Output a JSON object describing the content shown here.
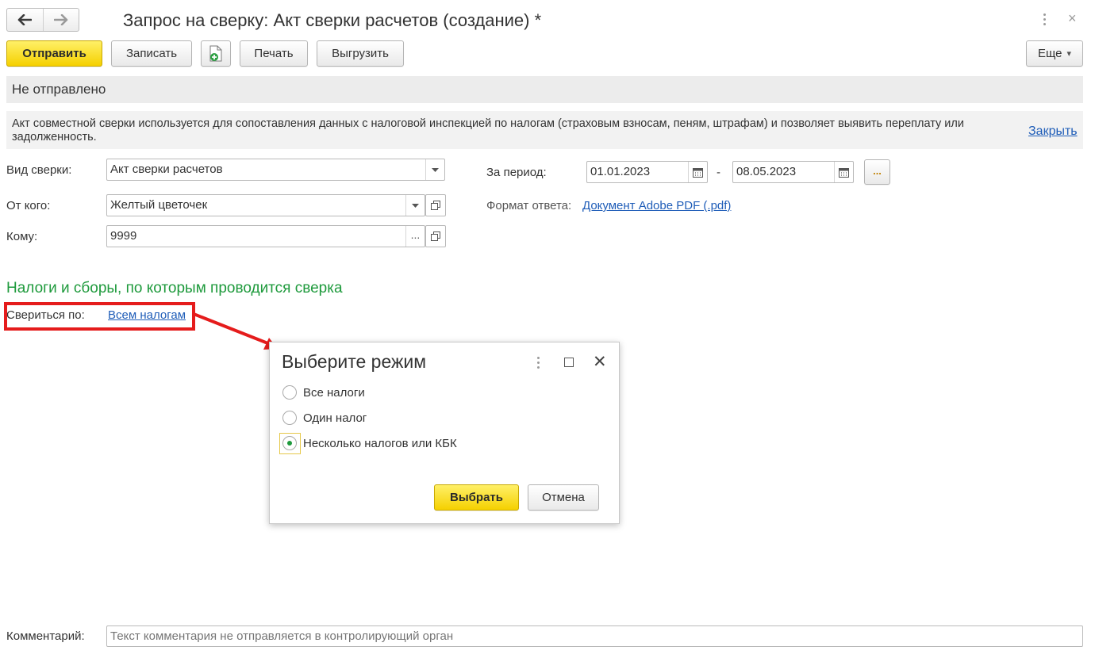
{
  "window": {
    "title": "Запрос на сверку: Акт сверки расчетов (создание) *",
    "close_glyph": "×"
  },
  "toolbar": {
    "send_label": "Отправить",
    "save_label": "Записать",
    "print_label": "Печать",
    "export_label": "Выгрузить",
    "more_label": "Еще",
    "more_arrow": "▾"
  },
  "status": "Не отправлено",
  "info": {
    "text": "Акт совместной сверки используется для сопоставления данных с налоговой инспекцией по налогам (страховым взносам, пеням, штрафам) и позволяет выявить переплату или задолженность.",
    "close_label": "Закрыть"
  },
  "form": {
    "type_label": "Вид сверки:",
    "type_value": "Акт сверки расчетов",
    "from_label": "От кого:",
    "from_value": "Желтый цветочек",
    "to_label": "Кому:",
    "to_value": "9999",
    "period_label": "За период:",
    "period_start": "01.01.2023",
    "period_dash": "-",
    "period_end": "08.05.2023",
    "format_label": "Формат ответа:",
    "format_value": "Документ Adobe PDF (.pdf)",
    "dots": "..."
  },
  "taxes": {
    "section_title": "Налоги и сборы, по которым проводится сверка",
    "reconcile_label": "Свериться по:",
    "reconcile_value": "Всем налогам"
  },
  "dialog": {
    "title": "Выберите режим",
    "close_glyph": "✕",
    "options": [
      {
        "label": "Все налоги",
        "selected": false
      },
      {
        "label": "Один налог",
        "selected": false
      },
      {
        "label": "Несколько налогов или КБК",
        "selected": true
      }
    ],
    "select_label": "Выбрать",
    "cancel_label": "Отмена"
  },
  "comment": {
    "label": "Комментарий:",
    "placeholder": "Текст комментария не отправляется в контролирующий орган"
  },
  "colors": {
    "primary_button": "#f5d000",
    "section_title": "#1e9a3c",
    "link": "#1f5db8",
    "highlight": "#e51c1c",
    "radio_selected": "#1e9a3c"
  },
  "icons": [
    "back-arrow-icon",
    "forward-arrow-icon",
    "more-vertical-icon",
    "close-icon",
    "new-document-icon",
    "dropdown-arrow-icon",
    "open-form-icon",
    "calendar-icon",
    "maximize-icon"
  ]
}
